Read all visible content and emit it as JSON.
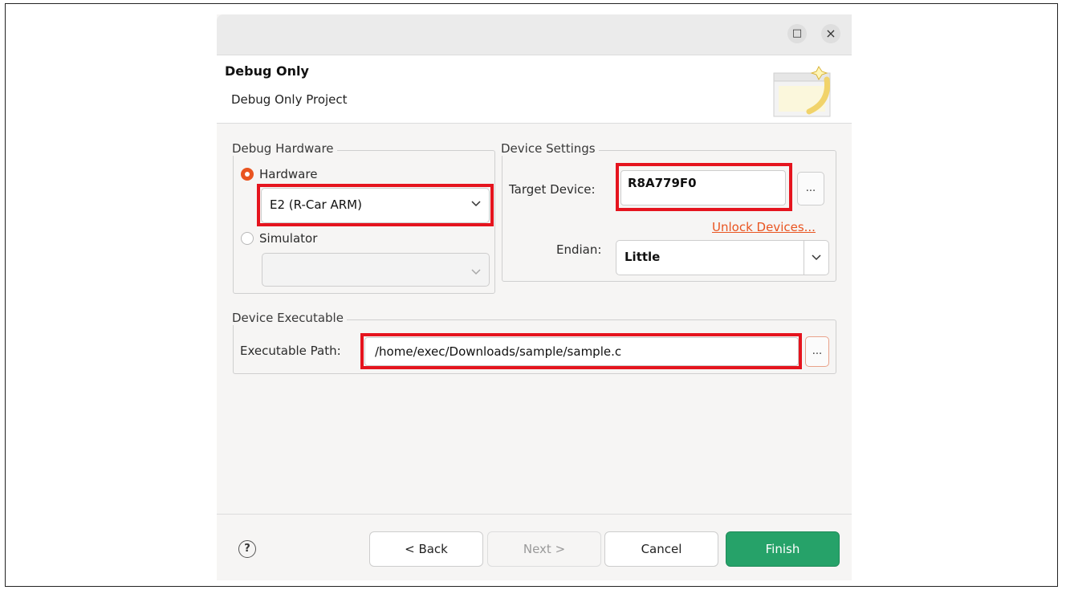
{
  "titlebar": {
    "maximize_glyph": "□",
    "close_glyph": "×"
  },
  "header": {
    "title": "Debug Only",
    "subtitle": "Debug Only Project"
  },
  "debug_hardware": {
    "group_label": "Debug Hardware",
    "hardware_label": "Hardware",
    "hardware_selected": true,
    "hardware_value": "E2 (R-Car ARM)",
    "simulator_label": "Simulator",
    "simulator_selected": false,
    "simulator_value": ""
  },
  "device_settings": {
    "group_label": "Device Settings",
    "target_device_label": "Target Device:",
    "target_device_value": "R8A779F0",
    "browse_label": "...",
    "unlock_link": "Unlock Devices...",
    "endian_label": "Endian:",
    "endian_value": "Little"
  },
  "device_executable": {
    "group_label": "Device Executable",
    "path_label": "Executable Path:",
    "path_value": "/home/exec/Downloads/sample/sample.c",
    "browse_label": "..."
  },
  "footer": {
    "help_glyph": "?",
    "back_label": "< Back",
    "next_label": "Next >",
    "cancel_label": "Cancel",
    "finish_label": "Finish"
  },
  "colors": {
    "accent": "#e95420",
    "highlight": "#e5141e",
    "finish": "#26a269"
  }
}
